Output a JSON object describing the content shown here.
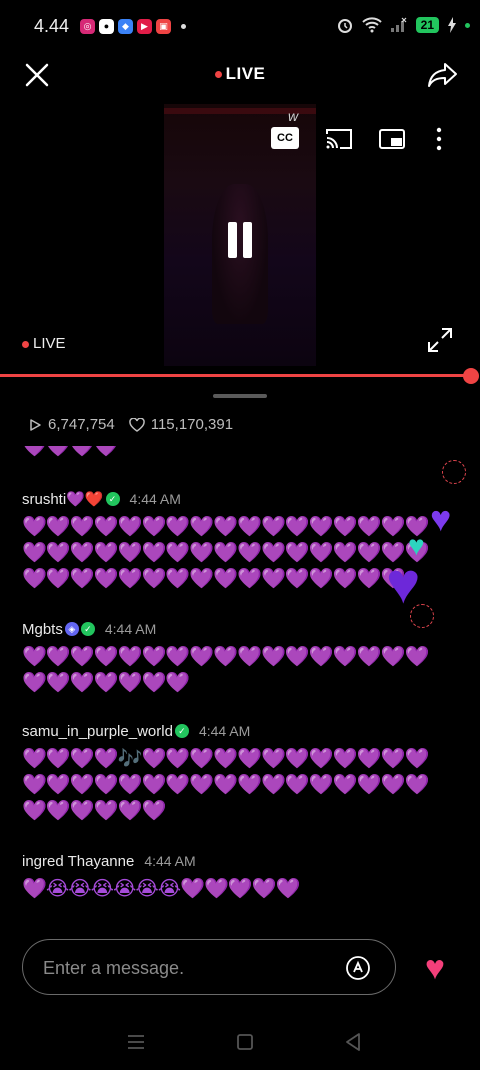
{
  "status_bar": {
    "time": "4.44",
    "battery": "21"
  },
  "top_bar": {
    "live_label": "LIVE"
  },
  "video": {
    "watermark": "w",
    "cc_label": "CC",
    "live_label": "LIVE",
    "progress": 1.0
  },
  "stats": {
    "views": "6,747,754",
    "likes": "115,170,391"
  },
  "chat": {
    "partial_row": "💜💜💜💜",
    "messages": [
      {
        "username": "srushti💜❤️",
        "time": "4:44 AM",
        "lines": [
          "💜💜💜💜💜💜💜💜💜💜💜💜💜💜💜💜💜",
          "💜💜💜💜💜💜💜💜💜💜💜💜💜💜💜💜💜",
          "💜💜💜💜💜💜💜💜💜💜💜💜💜💜💜💜"
        ]
      },
      {
        "username": "Mgbts",
        "time": "4:44 AM",
        "lines": [
          "💜💜💜💜💜💜💜💜💜💜💜💜💜💜💜💜💜",
          "💜💜💜💜💜💜💜"
        ]
      },
      {
        "username": "samu_in_purple_world",
        "time": "4:44 AM",
        "lines": [
          "💜💜💜💜🎶💜💜💜💜💜💜💜💜💜💜💜💜",
          "💜💜💜💜💜💜💜💜💜💜💜💜💜💜💜💜💜",
          "💜💜💜💜💜💜"
        ]
      },
      {
        "username": "ingred Thayanne",
        "time": "4:44 AM",
        "lines": [
          "💜😭😭😭😭😭😭💜💜💜💜💜"
        ]
      }
    ]
  },
  "composer": {
    "placeholder": "Enter a message."
  },
  "icons": {
    "close": "close-icon",
    "share": "share-icon",
    "cast": "cast-icon",
    "pip": "picture-in-picture-icon",
    "more": "more-vertical-icon",
    "pause": "pause-icon",
    "expand": "expand-icon",
    "views": "play-icon",
    "likes": "heart-outline-icon",
    "translate": "translate-icon",
    "like": "heart-icon"
  },
  "colors": {
    "accent": "#ef4444",
    "heart_purple": "#a64bd9",
    "like_pink": "#f43f7a",
    "verified_green": "#22c55e"
  }
}
